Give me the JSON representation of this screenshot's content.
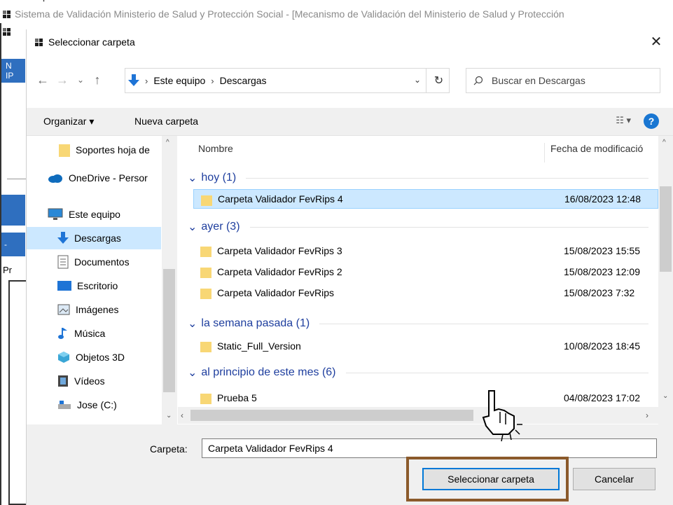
{
  "background_window": {
    "title": "Sistema de Validación Ministerio de Salud y Protección Social - [Mecanismo de Validación del Ministerio de Salud y Protección",
    "edge_text_top": "N\nIP",
    "edge_text_mid": "-",
    "edge_text_low": "Pr"
  },
  "dialog": {
    "title": "Seleccionar carpeta",
    "close_icon": "close-icon",
    "address": {
      "crumbs": [
        "Este equipo",
        "Descargas"
      ],
      "separator": "›"
    },
    "search_placeholder": "Buscar en Descargas",
    "toolbar": {
      "organize": "Organizar ▾",
      "new_folder": "Nueva carpeta",
      "help": "?",
      "view": "☷ ▾"
    },
    "nav": [
      {
        "label": "Soportes hoja de",
        "icon": "folder-icon"
      },
      {
        "label": "OneDrive - Persor",
        "icon": "cloud-icon"
      },
      {
        "label": "Este equipo",
        "icon": "computer-icon"
      },
      {
        "label": "Descargas",
        "icon": "download-icon",
        "selected": true
      },
      {
        "label": "Documentos",
        "icon": "document-icon"
      },
      {
        "label": "Escritorio",
        "icon": "desktop-icon"
      },
      {
        "label": "Imágenes",
        "icon": "image-icon"
      },
      {
        "label": "Música",
        "icon": "music-icon"
      },
      {
        "label": "Objetos 3D",
        "icon": "cube-icon"
      },
      {
        "label": "Vídeos",
        "icon": "video-icon"
      },
      {
        "label": "Jose (C:)",
        "icon": "drive-icon"
      }
    ],
    "columns": {
      "name": "Nombre",
      "date": "Fecha de modificació"
    },
    "groups": [
      {
        "label": "hoy (1)",
        "rows": [
          {
            "name": "Carpeta Validador FevRips 4",
            "date": "16/08/2023 12:48",
            "selected": true
          }
        ]
      },
      {
        "label": "ayer (3)",
        "rows": [
          {
            "name": "Carpeta Validador FevRips 3",
            "date": "15/08/2023 15:55"
          },
          {
            "name": "Carpeta Validador FevRips 2",
            "date": "15/08/2023 12:09"
          },
          {
            "name": "Carpeta Validador FevRips",
            "date": "15/08/2023 7:32"
          }
        ]
      },
      {
        "label": "la semana pasada (1)",
        "rows": [
          {
            "name": "Static_Full_Version",
            "date": "10/08/2023 18:45"
          }
        ]
      },
      {
        "label": "al principio de este mes (6)",
        "rows": [
          {
            "name": "Prueba 5",
            "date": "04/08/2023 17:02"
          }
        ]
      }
    ],
    "folder_label": "Carpeta:",
    "folder_value": "Carpeta Validador FevRips 4",
    "select_button": "Seleccionar carpeta",
    "cancel_button": "Cancelar"
  },
  "colors": {
    "selection": "#cce8ff",
    "group_text": "#1e3e9e",
    "highlight_box": "#8b5a2b",
    "folder": "#f8d775"
  }
}
